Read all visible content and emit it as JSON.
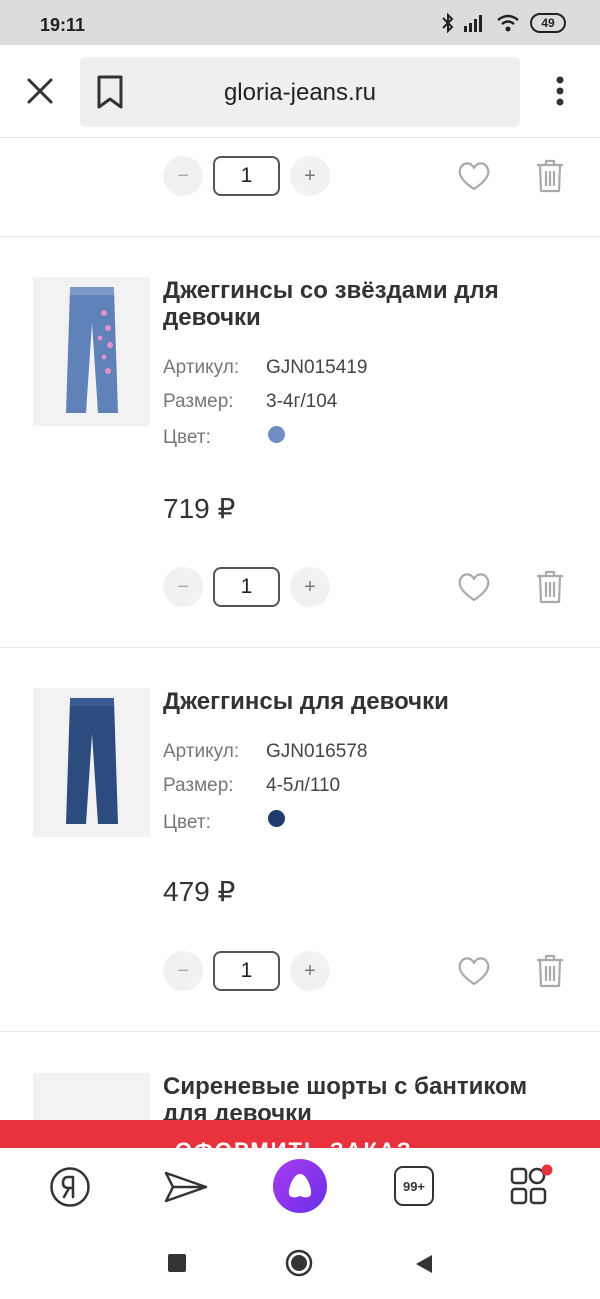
{
  "status": {
    "time": "19:11",
    "battery": "49"
  },
  "browser": {
    "url": "gloria-jeans.ru"
  },
  "top_item": {
    "qty": "1"
  },
  "products": [
    {
      "title": "Джеггинсы со звёздами для девочки",
      "article_label": "Артикул:",
      "article": "GJN015419",
      "size_label": "Размер:",
      "size": "3-4г/104",
      "color_label": "Цвет:",
      "color": "#6f8fc2",
      "price": "719 ₽",
      "qty": "1"
    },
    {
      "title": "Джеггинсы для девочки",
      "article_label": "Артикул:",
      "article": "GJN016578",
      "size_label": "Размер:",
      "size": "4-5л/110",
      "color_label": "Цвет:",
      "color": "#1f3a6b",
      "price": "479 ₽",
      "qty": "1"
    },
    {
      "title": "Сиреневые шорты с бантиком для девочки"
    }
  ],
  "qty_controls": {
    "minus": "−",
    "plus": "+"
  },
  "checkout": {
    "label": "ОФОРМИТЬ ЗАКАЗ"
  },
  "bottom_nav": {
    "tabs_count": "99+"
  }
}
